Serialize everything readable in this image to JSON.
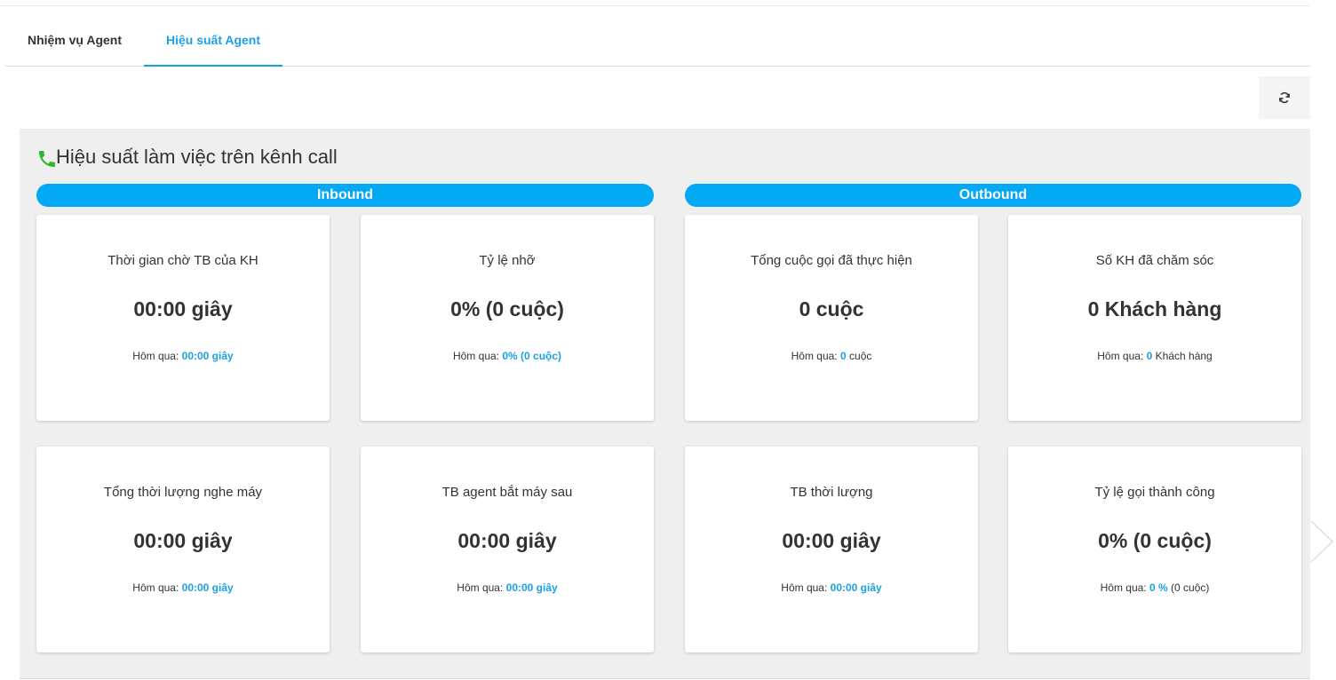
{
  "tabs": [
    {
      "label": "Nhiệm vụ Agent",
      "active": false
    },
    {
      "label": "Hiệu suất Agent",
      "active": true
    }
  ],
  "panel": {
    "title": "Hiệu suất làm việc trên kênh call",
    "inbound_label": "Inbound",
    "outbound_label": "Outbound"
  },
  "cards": [
    {
      "title": "Thời gian chờ TB của KH",
      "value": "00:00 giây",
      "foot_prefix": "Hôm qua:",
      "foot_highlight": "00:00 giây",
      "foot_suffix": ""
    },
    {
      "title": "Tỷ lệ nhỡ",
      "value": "0% (0 cuộc)",
      "foot_prefix": "Hôm qua:",
      "foot_highlight": "0% (0 cuộc)",
      "foot_suffix": ""
    },
    {
      "title": "Tổng cuộc gọi đã thực hiện",
      "value": "0 cuộc",
      "foot_prefix": "Hôm qua:",
      "foot_highlight": "0",
      "foot_suffix": "cuộc"
    },
    {
      "title": "Số KH đã chăm sóc",
      "value": "0 Khách hàng",
      "foot_prefix": "Hôm qua:",
      "foot_highlight": "0",
      "foot_suffix": "Khách hàng"
    },
    {
      "title": "Tổng thời lượng nghe máy",
      "value": "00:00 giây",
      "foot_prefix": "Hôm qua:",
      "foot_highlight": "00:00 giây",
      "foot_suffix": ""
    },
    {
      "title": "TB agent bắt máy sau",
      "value": "00:00 giây",
      "foot_prefix": "Hôm qua:",
      "foot_highlight": "00:00 giây",
      "foot_suffix": ""
    },
    {
      "title": "TB thời lượng",
      "value": "00:00 giây",
      "foot_prefix": "Hôm qua:",
      "foot_highlight": "00:00 giây",
      "foot_suffix": ""
    },
    {
      "title": "Tỷ lệ gọi thành công",
      "value": "0% (0 cuộc)",
      "foot_prefix": "Hôm qua:",
      "foot_highlight": "0 %",
      "foot_suffix": "(0 cuộc)"
    }
  ],
  "colors": {
    "accent": "#1ba1e2",
    "bar": "#03a9f4",
    "phone_icon": "#2eb82e"
  },
  "icons": {
    "refresh": "refresh-icon",
    "phone": "phone-icon",
    "next": "chevron-right-icon"
  }
}
